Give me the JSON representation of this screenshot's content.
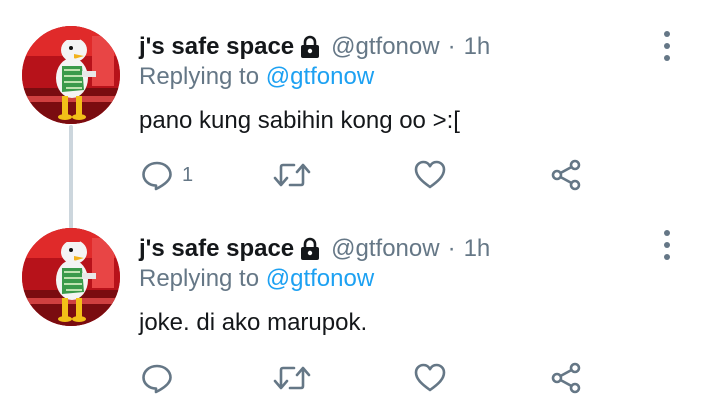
{
  "tweets": [
    {
      "display_name": "j's safe space",
      "handle": "@gtfonow",
      "separator": "·",
      "time": "1h",
      "replying_prefix": "Replying to",
      "replying_to": "@gtfonow",
      "text": "pano kung sabihin kong oo >:[",
      "reply_count": "1"
    },
    {
      "display_name": "j's safe space",
      "handle": "@gtfonow",
      "separator": "·",
      "time": "1h",
      "replying_prefix": "Replying to",
      "replying_to": "@gtfonow",
      "text": "joke. di ako marupok.",
      "reply_count": ""
    }
  ],
  "icons": {
    "lock": "lock-icon",
    "menu": "more-vertical-icon",
    "reply": "speech-bubble-icon",
    "retweet": "retweet-icon",
    "like": "heart-icon",
    "share": "share-icon"
  },
  "colors": {
    "link": "#1da1f2",
    "secondary_text": "#657786",
    "primary_text": "#14171a",
    "thread_line": "#ccd6dd",
    "avatar_background": "#c91d1d"
  }
}
